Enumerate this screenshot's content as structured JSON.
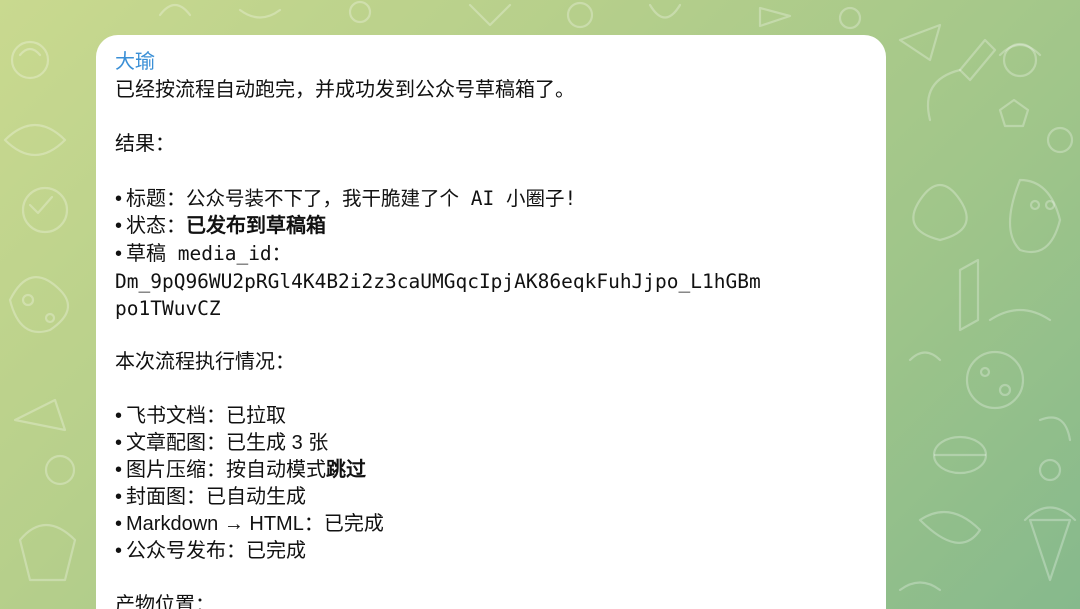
{
  "message": {
    "sender": "大瑜",
    "intro": "已经按流程自动跑完，并成功发到公众号草稿箱了。",
    "result_heading": "结果：",
    "result_items": {
      "title_label": "标题：",
      "title_value": "公众号装不下了，我干脆建了个 AI 小圈子!",
      "status_label": "状态：",
      "status_value": "已发布到草稿箱",
      "draft_label": "草稿",
      "draft_key": " media_id：",
      "media_id_line1": "Dm_9pQ96WU2pRGl4K4B2i2z3caUMGqcIpjAK86eqkFuhJjpo_L1hGBm",
      "media_id_line2": "po1TWuvCZ"
    },
    "process_heading": "本次流程执行情况：",
    "process_items": [
      {
        "label": "飞书文档：",
        "value": "已拉取",
        "value_bold": ""
      },
      {
        "label": "文章配图：",
        "value": "已生成 3 张",
        "value_bold": ""
      },
      {
        "label": "图片压缩：",
        "value": "按自动模式",
        "value_bold": "跳过"
      },
      {
        "label": "封面图：",
        "value": "已自动生成",
        "value_bold": ""
      },
      {
        "label": "Markdown → HTML：",
        "value": "已完成",
        "value_bold": ""
      },
      {
        "label": "公众号发布：",
        "value": "已完成",
        "value_bold": ""
      }
    ],
    "output_heading": "产物位置："
  },
  "bullet_char": "•"
}
